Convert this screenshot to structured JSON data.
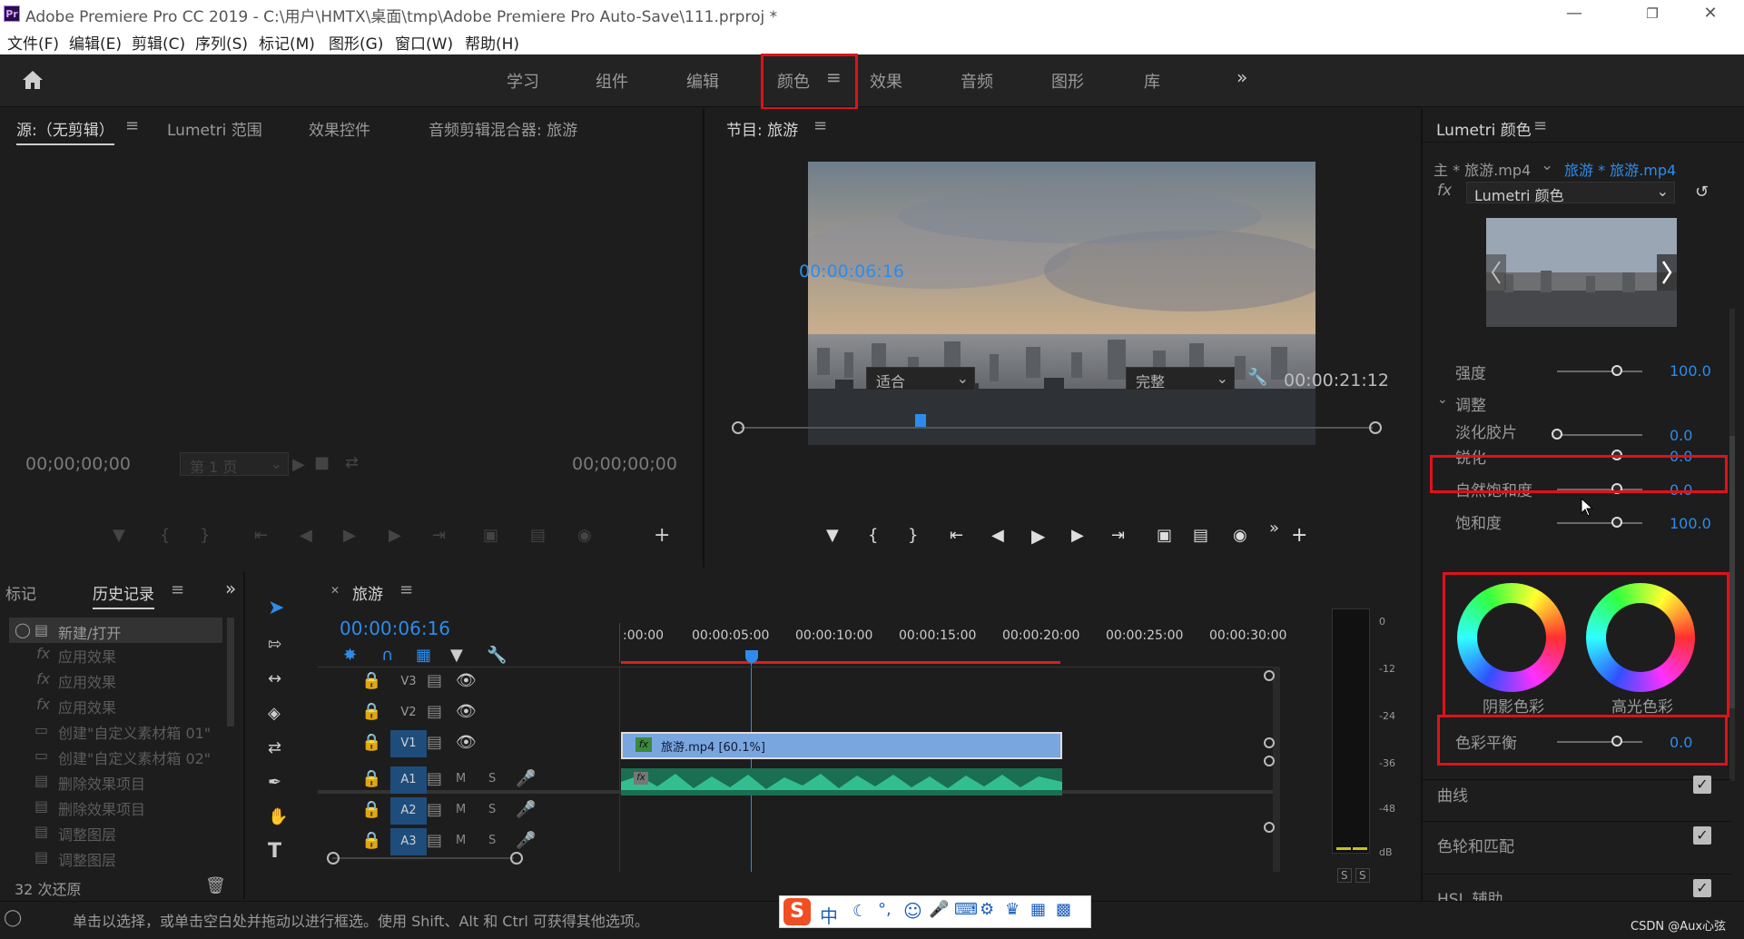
{
  "window": {
    "title": "Adobe Premiere Pro CC 2019 - C:\\用户\\HMTX\\桌面\\tmp\\Adobe Premiere Pro Auto-Save\\111.prproj *",
    "app_icon": "Pr"
  },
  "menu": [
    "文件(F)",
    "编辑(E)",
    "剪辑(C)",
    "序列(S)",
    "标记(M)",
    "图形(G)",
    "窗口(W)",
    "帮助(H)"
  ],
  "workspaces": [
    "学习",
    "组件",
    "编辑",
    "颜色",
    "效果",
    "音频",
    "图形",
    "库"
  ],
  "active_workspace": "颜色",
  "source_panel": {
    "tabs": [
      "源:（无剪辑）",
      "Lumetri 范围",
      "效果控件",
      "音频剪辑混合器: 旅游"
    ],
    "timecode_left": "00;00;00;00",
    "page_select": "第 1 页",
    "timecode_right": "00;00;00;00"
  },
  "program_panel": {
    "title": "节目: 旅游",
    "timecode": "00:00:06:16",
    "fit": "适合",
    "quality": "完整",
    "duration": "00:00:21:12"
  },
  "lumetri": {
    "title": "Lumetri 颜色",
    "master_clip": "主 * 旅游.mp4",
    "sequence_clip": "旅游 * 旅游.mp4",
    "effect": "Lumetri 颜色",
    "intensity_label": "强度",
    "intensity_value": "100.0",
    "adjust_label": "调整",
    "faded_film_label": "淡化胶片",
    "faded_film_value": "0.0",
    "sharpen_label": "锐化",
    "sharpen_value": "0.0",
    "vibrance_label": "自然饱和度",
    "vibrance_value": "0.0",
    "saturation_label": "饱和度",
    "saturation_value": "100.0",
    "shadow_tint_label": "阴影色彩",
    "highlight_tint_label": "高光色彩",
    "balance_label": "色彩平衡",
    "balance_value": "0.0",
    "sections": [
      "曲线",
      "色轮和匹配",
      "HSL 辅助"
    ]
  },
  "history_panel": {
    "tabs": [
      "标记",
      "历史记录"
    ],
    "items": [
      "新建/打开",
      "应用效果",
      "应用效果",
      "应用效果",
      "创建\"自定义素材箱 01\"",
      "创建\"自定义素材箱 02\"",
      "删除效果项目",
      "删除效果项目",
      "调整图层",
      "调整图层"
    ],
    "undo_count": "32 次还原"
  },
  "timeline": {
    "sequence_name": "旅游",
    "timecode": "00:00:06:16",
    "ruler": [
      ":00:00",
      "00:00:05:00",
      "00:00:10:00",
      "00:00:15:00",
      "00:00:20:00",
      "00:00:25:00",
      "00:00:30:00"
    ],
    "video_tracks": [
      "V3",
      "V2",
      "V1"
    ],
    "audio_tracks": [
      "A1",
      "A2",
      "A3"
    ],
    "clip_label": "旅游.mp4 [60.1%]",
    "fx_badge": "fx",
    "mute": "M",
    "solo": "S"
  },
  "meter": {
    "scale": [
      "0",
      "-12",
      "-24",
      "-36",
      "-48",
      "dB"
    ],
    "solo_labels": [
      "S",
      "S"
    ]
  },
  "status": {
    "hint": "单击以选择，或单击空白处并拖动以进行框选。使用 Shift、Alt 和 Ctrl 可获得其他选项。",
    "watermark": "CSDN @Aux心弦"
  },
  "ime_bar": {
    "label": "中"
  },
  "colors": {
    "accent_blue": "#2d8ceb",
    "highlight_red": "#e0111a",
    "clip_blue": "#7aa6df",
    "audio_green": "#2aa87a"
  }
}
